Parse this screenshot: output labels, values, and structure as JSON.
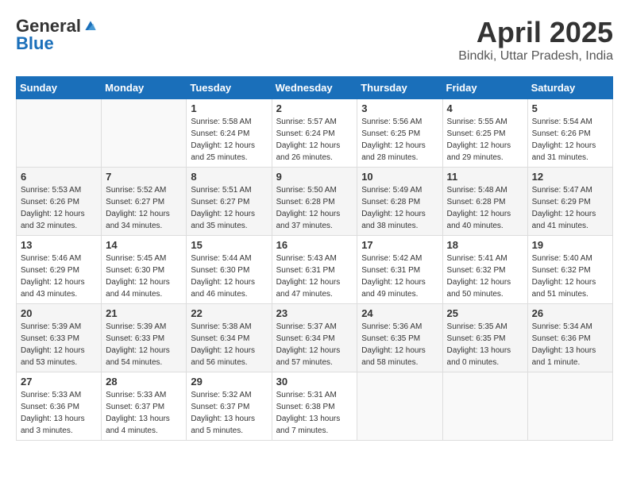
{
  "header": {
    "logo_general": "General",
    "logo_blue": "Blue",
    "month_title": "April 2025",
    "location": "Bindki, Uttar Pradesh, India"
  },
  "days_of_week": [
    "Sunday",
    "Monday",
    "Tuesday",
    "Wednesday",
    "Thursday",
    "Friday",
    "Saturday"
  ],
  "weeks": [
    [
      {
        "day": "",
        "info": ""
      },
      {
        "day": "",
        "info": ""
      },
      {
        "day": "1",
        "info": "Sunrise: 5:58 AM\nSunset: 6:24 PM\nDaylight: 12 hours and 25 minutes."
      },
      {
        "day": "2",
        "info": "Sunrise: 5:57 AM\nSunset: 6:24 PM\nDaylight: 12 hours and 26 minutes."
      },
      {
        "day": "3",
        "info": "Sunrise: 5:56 AM\nSunset: 6:25 PM\nDaylight: 12 hours and 28 minutes."
      },
      {
        "day": "4",
        "info": "Sunrise: 5:55 AM\nSunset: 6:25 PM\nDaylight: 12 hours and 29 minutes."
      },
      {
        "day": "5",
        "info": "Sunrise: 5:54 AM\nSunset: 6:26 PM\nDaylight: 12 hours and 31 minutes."
      }
    ],
    [
      {
        "day": "6",
        "info": "Sunrise: 5:53 AM\nSunset: 6:26 PM\nDaylight: 12 hours and 32 minutes."
      },
      {
        "day": "7",
        "info": "Sunrise: 5:52 AM\nSunset: 6:27 PM\nDaylight: 12 hours and 34 minutes."
      },
      {
        "day": "8",
        "info": "Sunrise: 5:51 AM\nSunset: 6:27 PM\nDaylight: 12 hours and 35 minutes."
      },
      {
        "day": "9",
        "info": "Sunrise: 5:50 AM\nSunset: 6:28 PM\nDaylight: 12 hours and 37 minutes."
      },
      {
        "day": "10",
        "info": "Sunrise: 5:49 AM\nSunset: 6:28 PM\nDaylight: 12 hours and 38 minutes."
      },
      {
        "day": "11",
        "info": "Sunrise: 5:48 AM\nSunset: 6:28 PM\nDaylight: 12 hours and 40 minutes."
      },
      {
        "day": "12",
        "info": "Sunrise: 5:47 AM\nSunset: 6:29 PM\nDaylight: 12 hours and 41 minutes."
      }
    ],
    [
      {
        "day": "13",
        "info": "Sunrise: 5:46 AM\nSunset: 6:29 PM\nDaylight: 12 hours and 43 minutes."
      },
      {
        "day": "14",
        "info": "Sunrise: 5:45 AM\nSunset: 6:30 PM\nDaylight: 12 hours and 44 minutes."
      },
      {
        "day": "15",
        "info": "Sunrise: 5:44 AM\nSunset: 6:30 PM\nDaylight: 12 hours and 46 minutes."
      },
      {
        "day": "16",
        "info": "Sunrise: 5:43 AM\nSunset: 6:31 PM\nDaylight: 12 hours and 47 minutes."
      },
      {
        "day": "17",
        "info": "Sunrise: 5:42 AM\nSunset: 6:31 PM\nDaylight: 12 hours and 49 minutes."
      },
      {
        "day": "18",
        "info": "Sunrise: 5:41 AM\nSunset: 6:32 PM\nDaylight: 12 hours and 50 minutes."
      },
      {
        "day": "19",
        "info": "Sunrise: 5:40 AM\nSunset: 6:32 PM\nDaylight: 12 hours and 51 minutes."
      }
    ],
    [
      {
        "day": "20",
        "info": "Sunrise: 5:39 AM\nSunset: 6:33 PM\nDaylight: 12 hours and 53 minutes."
      },
      {
        "day": "21",
        "info": "Sunrise: 5:39 AM\nSunset: 6:33 PM\nDaylight: 12 hours and 54 minutes."
      },
      {
        "day": "22",
        "info": "Sunrise: 5:38 AM\nSunset: 6:34 PM\nDaylight: 12 hours and 56 minutes."
      },
      {
        "day": "23",
        "info": "Sunrise: 5:37 AM\nSunset: 6:34 PM\nDaylight: 12 hours and 57 minutes."
      },
      {
        "day": "24",
        "info": "Sunrise: 5:36 AM\nSunset: 6:35 PM\nDaylight: 12 hours and 58 minutes."
      },
      {
        "day": "25",
        "info": "Sunrise: 5:35 AM\nSunset: 6:35 PM\nDaylight: 13 hours and 0 minutes."
      },
      {
        "day": "26",
        "info": "Sunrise: 5:34 AM\nSunset: 6:36 PM\nDaylight: 13 hours and 1 minute."
      }
    ],
    [
      {
        "day": "27",
        "info": "Sunrise: 5:33 AM\nSunset: 6:36 PM\nDaylight: 13 hours and 3 minutes."
      },
      {
        "day": "28",
        "info": "Sunrise: 5:33 AM\nSunset: 6:37 PM\nDaylight: 13 hours and 4 minutes."
      },
      {
        "day": "29",
        "info": "Sunrise: 5:32 AM\nSunset: 6:37 PM\nDaylight: 13 hours and 5 minutes."
      },
      {
        "day": "30",
        "info": "Sunrise: 5:31 AM\nSunset: 6:38 PM\nDaylight: 13 hours and 7 minutes."
      },
      {
        "day": "",
        "info": ""
      },
      {
        "day": "",
        "info": ""
      },
      {
        "day": "",
        "info": ""
      }
    ]
  ]
}
